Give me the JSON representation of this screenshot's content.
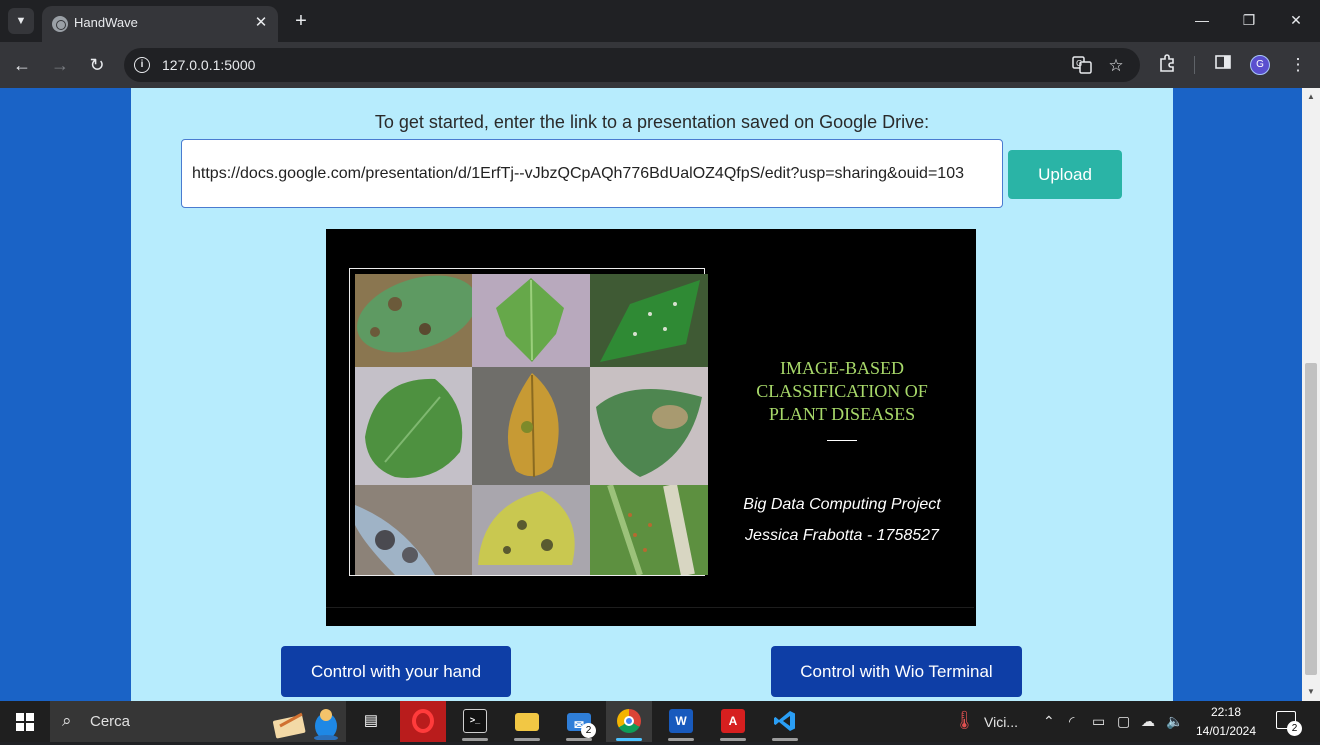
{
  "browser": {
    "tab_title": "HandWave",
    "url": "127.0.0.1:5000",
    "new_tab_symbol": "+",
    "tab_close_symbol": "✕"
  },
  "page": {
    "prompt": "To get started, enter the link to a presentation saved on Google Drive:",
    "link_value": "https://docs.google.com/presentation/d/1ErfTj--vJbzQCpAQh776BdUalOZ4QfpS/edit?usp=sharing&ouid=103",
    "upload_label": "Upload",
    "control_hand_label": "Control with your hand",
    "control_wio_label": "Control with Wio Terminal"
  },
  "slide": {
    "title_line1": "IMAGE-BASED",
    "title_line2": "CLASSIFICATION OF",
    "title_line3": "PLANT DISEASES",
    "subtitle": "Big Data Computing Project",
    "author": "Jessica Frabotta - 1758527"
  },
  "taskbar": {
    "search_text": "Cerca",
    "weather_text": "Vici...",
    "time": "22:18",
    "date": "14/01/2024",
    "mail_badge": "2",
    "notification_badge": "2"
  },
  "colors": {
    "page_background": "#1a63c6",
    "panel_background": "#b7ecfd",
    "upload_button": "#2ab4a6",
    "control_button": "#0e3ea6",
    "slide_title": "#a8d96a"
  }
}
